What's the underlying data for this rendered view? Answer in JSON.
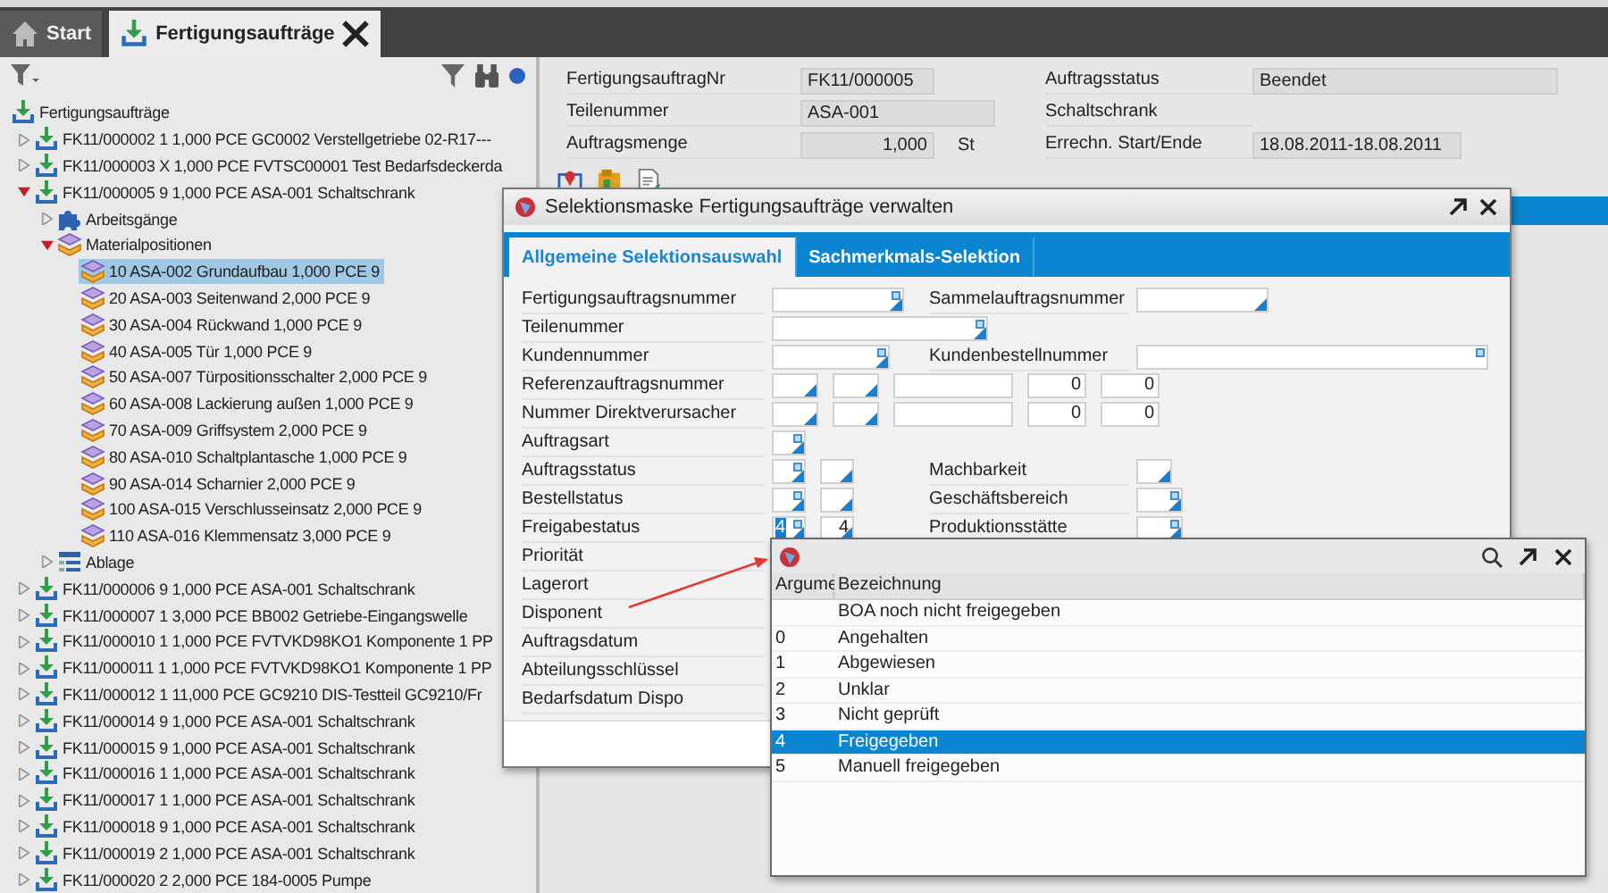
{
  "tabs": [
    {
      "label": "Start",
      "kind": "home",
      "selected": false,
      "closable": false
    },
    {
      "label": "Fertigungsaufträge",
      "kind": "orders",
      "selected": true,
      "closable": true
    }
  ],
  "tree": {
    "items": [
      {
        "label": "Fertigungsaufträge",
        "kind": "root",
        "selected": false,
        "children": [
          {
            "label": "FK11/000002 1 1,000 PCE GC0002 Verstellgetriebe 02-R17---",
            "kind": "order",
            "expanded": false,
            "selected": false
          },
          {
            "label": "FK11/000003 X 1,000 PCE FVTSC00001 Test Bedarfsdeckerda",
            "kind": "order",
            "expanded": false,
            "selected": false
          },
          {
            "label": "FK11/000005 9 1,000 PCE ASA-001 Schaltschrank",
            "kind": "order",
            "expanded": true,
            "selected": false,
            "children": [
              {
                "label": "Arbeitsgänge",
                "kind": "operations",
                "expanded": false,
                "selected": false
              },
              {
                "label": "Materialpositionen",
                "kind": "materials",
                "expanded": true,
                "selected": false,
                "children": [
                  {
                    "label": "10 ASA-002 Grundaufbau 1,000 PCE 9",
                    "kind": "material",
                    "selected": true
                  },
                  {
                    "label": "20 ASA-003 Seitenwand 2,000 PCE 9",
                    "kind": "material",
                    "selected": false
                  },
                  {
                    "label": "30 ASA-004 Rückwand 1,000 PCE 9",
                    "kind": "material",
                    "selected": false
                  },
                  {
                    "label": "40 ASA-005 Tür 1,000 PCE 9",
                    "kind": "material",
                    "selected": false
                  },
                  {
                    "label": "50 ASA-007 Türpositionsschalter 2,000 PCE 9",
                    "kind": "material",
                    "selected": false
                  },
                  {
                    "label": "60 ASA-008 Lackierung außen 1,000 PCE 9",
                    "kind": "material",
                    "selected": false
                  },
                  {
                    "label": "70 ASA-009 Griffsystem 2,000 PCE 9",
                    "kind": "material",
                    "selected": false
                  },
                  {
                    "label": "80 ASA-010 Schaltplantasche 1,000 PCE 9",
                    "kind": "material",
                    "selected": false
                  },
                  {
                    "label": "90 ASA-014 Scharnier 2,000 PCE 9",
                    "kind": "material",
                    "selected": false
                  },
                  {
                    "label": "100 ASA-015 Verschlusseinsatz 2,000 PCE 9",
                    "kind": "material",
                    "selected": false
                  },
                  {
                    "label": "110 ASA-016 Klemmensatz 3,000 PCE 9",
                    "kind": "material",
                    "selected": false
                  }
                ]
              },
              {
                "label": "Ablage",
                "kind": "archive",
                "expanded": false,
                "selected": false
              }
            ]
          },
          {
            "label": "FK11/000006 9 1,000 PCE ASA-001 Schaltschrank",
            "kind": "order",
            "expanded": false,
            "selected": false
          },
          {
            "label": "FK11/000007 1 3,000 PCE BB002 Getriebe-Eingangswelle",
            "kind": "order",
            "expanded": false,
            "selected": false
          },
          {
            "label": "FK11/000010 1 1,000 PCE FVTVKD98KO1 Komponente 1 PP",
            "kind": "order",
            "expanded": false,
            "selected": false
          },
          {
            "label": "FK11/000011 1 1,000 PCE FVTVKD98KO1 Komponente 1 PP",
            "kind": "order",
            "expanded": false,
            "selected": false
          },
          {
            "label": "FK11/000012 1 11,000 PCE GC9210 DIS-Testteil GC9210/Fr",
            "kind": "order",
            "expanded": false,
            "selected": false
          },
          {
            "label": "FK11/000014 9 1,000 PCE ASA-001 Schaltschrank",
            "kind": "order",
            "expanded": false,
            "selected": false
          },
          {
            "label": "FK11/000015 9 1,000 PCE ASA-001 Schaltschrank",
            "kind": "order",
            "expanded": false,
            "selected": false
          },
          {
            "label": "FK11/000016 1 1,000 PCE ASA-001 Schaltschrank",
            "kind": "order",
            "expanded": false,
            "selected": false
          },
          {
            "label": "FK11/000017 1 1,000 PCE ASA-001 Schaltschrank",
            "kind": "order",
            "expanded": false,
            "selected": false
          },
          {
            "label": "FK11/000018 9 1,000 PCE ASA-001 Schaltschrank",
            "kind": "order",
            "expanded": false,
            "selected": false
          },
          {
            "label": "FK11/000019 2 1,000 PCE ASA-001 Schaltschrank",
            "kind": "order",
            "expanded": false,
            "selected": false
          },
          {
            "label": "FK11/000020 2 2,000 PCE 184-0005 Pumpe",
            "kind": "order",
            "expanded": false,
            "selected": false
          }
        ]
      }
    ]
  },
  "order_header": {
    "left": [
      {
        "label": "FertigungsauftragNr",
        "value": "FK11/000005"
      },
      {
        "label": "Teilenummer",
        "value": "ASA-001"
      },
      {
        "label": "Auftragsmenge",
        "value": "1,000",
        "unit": "St"
      }
    ],
    "right": [
      {
        "label": "Auftragsstatus",
        "value": "Beendet"
      },
      {
        "label": "Schaltschrank"
      },
      {
        "label": "Errechn. Start/Ende",
        "value": "18.08.2011-18.08.2011"
      }
    ]
  },
  "dialog": {
    "title": "Selektionsmaske Fertigungsaufträge verwalten",
    "tabs": [
      {
        "label": "Allgemeine Selektionsauswahl",
        "selected": true
      },
      {
        "label": "Sachmerkmals-Selektion",
        "selected": false
      }
    ],
    "rows": [
      {
        "label": "Fertigungsauftragsnummer",
        "fields": [
          {
            "lookup": true,
            "dropdown": true
          }
        ],
        "right_label": "Sammelauftragsnummer",
        "right_fields": [
          {
            "lookup": false,
            "dropdown": true
          }
        ]
      },
      {
        "label": "Teilenummer",
        "fields": [
          {
            "lookup": true,
            "dropdown": true
          }
        ]
      },
      {
        "label": "Kundennummer",
        "fields": [
          {
            "lookup": true,
            "dropdown": true
          }
        ],
        "right_label": "Kundenbestellnummer",
        "right_fields": [
          {
            "lookup": true,
            "dropdown": false
          }
        ]
      },
      {
        "label": "Referenzauftragsnummer",
        "fields": [
          {
            "lookup": false,
            "dropdown": true
          },
          {
            "lookup": false,
            "dropdown": true
          },
          {
            "lookup": false,
            "dropdown": false
          },
          {
            "lookup": false,
            "dropdown": false,
            "value": "0"
          },
          {
            "lookup": false,
            "dropdown": false,
            "value": "0"
          }
        ]
      },
      {
        "label": "Nummer Direktverursacher",
        "fields": [
          {
            "lookup": false,
            "dropdown": true
          },
          {
            "lookup": false,
            "dropdown": true
          },
          {
            "lookup": false,
            "dropdown": false
          },
          {
            "lookup": false,
            "dropdown": false,
            "value": "0"
          },
          {
            "lookup": false,
            "dropdown": false,
            "value": "0"
          }
        ]
      },
      {
        "label": "Auftragsart",
        "fields": [
          {
            "lookup": true,
            "dropdown": true
          }
        ]
      },
      {
        "label": "Auftragsstatus",
        "fields": [
          {
            "lookup": true,
            "dropdown": true
          },
          {
            "lookup": false,
            "dropdown": true
          }
        ],
        "right_label": "Machbarkeit",
        "right_fields": [
          {
            "lookup": false,
            "dropdown": true
          }
        ]
      },
      {
        "label": "Bestellstatus",
        "fields": [
          {
            "lookup": true,
            "dropdown": true
          },
          {
            "lookup": false,
            "dropdown": true
          }
        ],
        "right_label": "Geschäftsbereich",
        "right_fields": [
          {
            "lookup": true,
            "dropdown": true
          }
        ]
      },
      {
        "label": "Freigabestatus",
        "fields": [
          {
            "lookup": true,
            "dropdown": true,
            "value": "4",
            "focused": true
          },
          {
            "lookup": false,
            "dropdown": true,
            "value": "4"
          }
        ],
        "right_label": "Produktionsstätte",
        "right_fields": [
          {
            "lookup": true,
            "dropdown": true
          }
        ]
      },
      {
        "label": "Priorität"
      },
      {
        "label": "Lagerort"
      },
      {
        "label": "Disponent"
      },
      {
        "label": "Auftragsdatum"
      },
      {
        "label": "Abteilungsschlüssel"
      },
      {
        "label": "Bedarfsdatum Dispo"
      }
    ]
  },
  "popup": {
    "columns": [
      "Argume",
      "Bezeichnung"
    ],
    "rows": [
      {
        "cells": [
          "",
          "BOA noch nicht freigegeben"
        ],
        "selected": false
      },
      {
        "cells": [
          "0",
          "Angehalten"
        ],
        "selected": false
      },
      {
        "cells": [
          "1",
          "Abgewiesen"
        ],
        "selected": false
      },
      {
        "cells": [
          "2",
          "Unklar"
        ],
        "selected": false
      },
      {
        "cells": [
          "3",
          "Nicht geprüft"
        ],
        "selected": false
      },
      {
        "cells": [
          "4",
          "Freigegeben"
        ],
        "selected": true
      },
      {
        "cells": [
          "5",
          "Manuell freigegeben"
        ],
        "selected": false
      }
    ]
  }
}
